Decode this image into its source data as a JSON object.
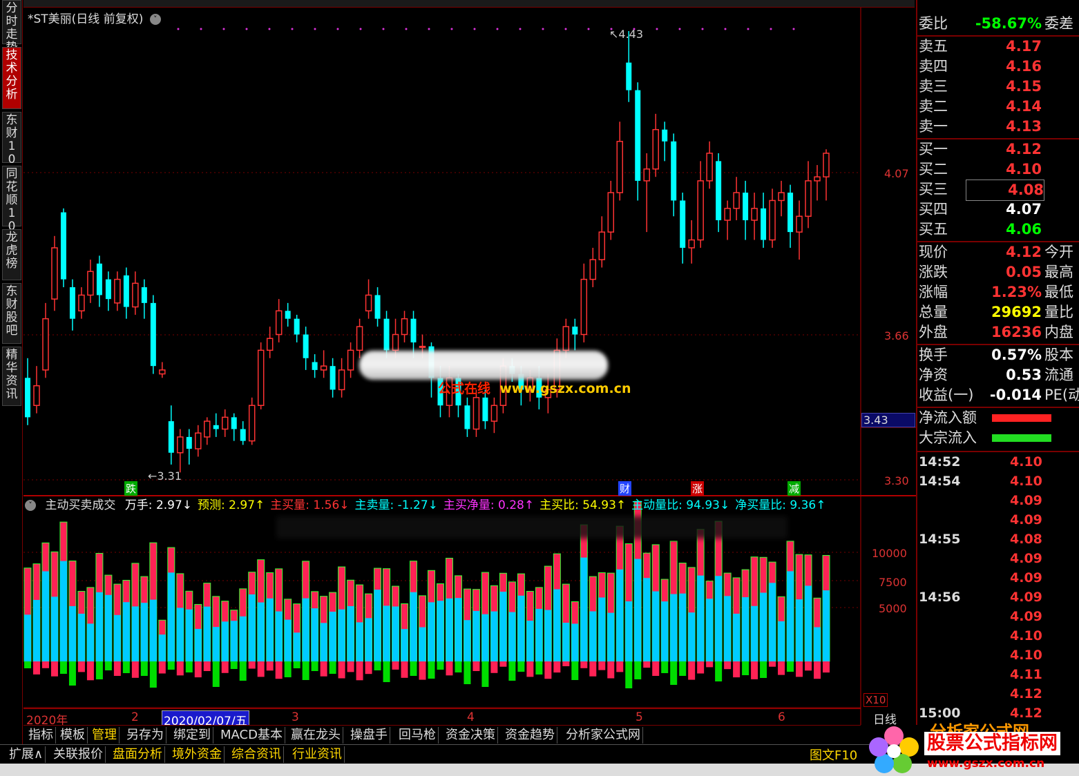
{
  "left_tabs": [
    {
      "label": "分时走势",
      "active": false
    },
    {
      "label": "技术分析",
      "active": true
    },
    {
      "label": "东财10",
      "active": false
    },
    {
      "label": "同花顺10",
      "active": false
    },
    {
      "label": "龙虎榜",
      "active": false
    },
    {
      "label": "东财股吧",
      "active": false
    },
    {
      "label": "精华资讯",
      "active": false
    }
  ],
  "chart_title": "*ST美丽(日线 前复权)",
  "title_icon": "chevron-down-icon",
  "price_axis": {
    "labels": [
      "4.07",
      "3.66",
      "3.30"
    ],
    "current_price": "3.43"
  },
  "annotations": {
    "high": "4.43",
    "low": "3.31"
  },
  "event_markers": [
    {
      "label": "跌",
      "color": "#00aa00"
    },
    {
      "label": "财",
      "color": "#2244ff"
    },
    {
      "label": "涨",
      "color": "#cc0000"
    },
    {
      "label": "减",
      "color": "#00aa00"
    }
  ],
  "indicator_header": {
    "name": "主动买卖成交",
    "items": [
      {
        "text": "万手: 2.97↓",
        "color": "#ffffff"
      },
      {
        "text": "预测: 2.97↑",
        "color": "#ffff00"
      },
      {
        "text": "主买量: 1.56↓",
        "color": "#ff3333"
      },
      {
        "text": "主卖量: -1.27↓",
        "color": "#00ffff"
      },
      {
        "text": "主买净量: 0.28↑",
        "color": "#ff33ff"
      },
      {
        "text": "主买比: 54.93↑",
        "color": "#ffff00"
      },
      {
        "text": "主动量比: 94.93↓",
        "color": "#00ffff"
      },
      {
        "text": "净买量比: 9.36↑",
        "color": "#00ffff"
      }
    ]
  },
  "volume_axis": {
    "labels": [
      "10000",
      "7500",
      "5000"
    ],
    "unit": "X10"
  },
  "date_axis": [
    {
      "label": "2020年",
      "selected": false
    },
    {
      "label": "2",
      "selected": false
    },
    {
      "label": "2020/02/07/五",
      "selected": true
    },
    {
      "label": "3",
      "selected": false
    },
    {
      "label": "4",
      "selected": false
    },
    {
      "label": "5",
      "selected": false
    },
    {
      "label": "6",
      "selected": false
    }
  ],
  "period_label": "日线",
  "bottom_tabs_1": [
    "指标",
    "模板",
    "管理",
    "另存为",
    "绑定到",
    "MACD基本",
    "赢在龙头",
    "操盘手",
    "回马枪",
    "资金决策",
    "资金趋势",
    "分析家公式网"
  ],
  "bottom_tabs_2": [
    "扩展∧",
    "关联报价",
    "盘面分析",
    "境外资金",
    "综合资讯",
    "行业资讯"
  ],
  "f10_button": "图文F10",
  "quote_panel": {
    "ratio": {
      "label": "委比",
      "value": "-58.67%",
      "ext": "委差"
    },
    "asks": [
      {
        "label": "卖五",
        "price": "4.17"
      },
      {
        "label": "卖四",
        "price": "4.16"
      },
      {
        "label": "卖三",
        "price": "4.15"
      },
      {
        "label": "卖二",
        "price": "4.14"
      },
      {
        "label": "卖一",
        "price": "4.13"
      }
    ],
    "bids": [
      {
        "label": "买一",
        "price": "4.12",
        "color": "#ff3333"
      },
      {
        "label": "买二",
        "price": "4.10",
        "color": "#ff3333"
      },
      {
        "label": "买三",
        "price": "4.08",
        "color": "#ff3333"
      },
      {
        "label": "买四",
        "price": "4.07",
        "color": "#ffffff"
      },
      {
        "label": "买五",
        "price": "4.06",
        "color": "#00ff00"
      }
    ],
    "stats": [
      {
        "label": "现价",
        "value": "4.12",
        "color": "#ff3333",
        "ext": "今开"
      },
      {
        "label": "涨跌",
        "value": "0.05",
        "color": "#ff3333",
        "ext": "最高"
      },
      {
        "label": "涨幅",
        "value": "1.23%",
        "color": "#ff3333",
        "ext": "最低"
      },
      {
        "label": "总量",
        "value": "29692",
        "color": "#ffff00",
        "ext": "量比"
      },
      {
        "label": "外盘",
        "value": "16236",
        "color": "#ff3333",
        "ext": "内盘"
      }
    ],
    "stats2": [
      {
        "label": "换手",
        "value": "0.57%",
        "color": "#ffffff",
        "ext": "股本"
      },
      {
        "label": "净资",
        "value": "0.53",
        "color": "#ffffff",
        "ext": "流通"
      },
      {
        "label": "收益(一)",
        "value": "-0.014",
        "color": "#ffffff",
        "ext": "PE(动"
      }
    ],
    "flows": [
      {
        "label": "净流入额",
        "color": "#ff2222"
      },
      {
        "label": "大宗流入",
        "color": "#22dd22"
      }
    ],
    "ticks": [
      {
        "time": "14:52",
        "price": "4.10"
      },
      {
        "time": "14:54",
        "price": "4.10"
      },
      {
        "time": "",
        "price": "4.09"
      },
      {
        "time": "",
        "price": "4.09"
      },
      {
        "time": "14:55",
        "price": "4.08"
      },
      {
        "time": "",
        "price": "4.09"
      },
      {
        "time": "",
        "price": "4.09"
      },
      {
        "time": "14:56",
        "price": "4.09"
      },
      {
        "time": "",
        "price": "4.09"
      },
      {
        "time": "",
        "price": "4.10"
      },
      {
        "time": "",
        "price": "4.10"
      },
      {
        "time": "",
        "price": "4.11"
      },
      {
        "time": "",
        "price": "4.12"
      },
      {
        "time": "15:00",
        "price": "4.12"
      }
    ]
  },
  "watermark": {
    "text": "公式在线",
    "url": "www.gszx.com.cn"
  },
  "logo": {
    "title": "分析家公式网",
    "text": "股票公式指标网",
    "url": "www.gszx.com.cn"
  },
  "colors": {
    "up": "#ff3333",
    "down": "#00ffff",
    "frame": "#b00000",
    "buy_bar": "#ff2255",
    "sell_bar": "#00ccff",
    "net_bar": "#00dd00"
  },
  "chart_data": {
    "type": "candlestick",
    "ylim": [
      3.3,
      4.43
    ],
    "candles": [
      [
        3.55,
        3.45,
        3.6,
        3.43
      ],
      [
        3.48,
        3.53,
        3.58,
        3.46
      ],
      [
        3.57,
        3.7,
        3.74,
        3.55
      ],
      [
        3.75,
        3.88,
        3.91,
        3.72
      ],
      [
        3.97,
        3.8,
        3.98,
        3.78
      ],
      [
        3.78,
        3.7,
        3.8,
        3.67
      ],
      [
        3.72,
        3.76,
        3.78,
        3.7
      ],
      [
        3.76,
        3.82,
        3.85,
        3.74
      ],
      [
        3.84,
        3.76,
        3.86,
        3.73
      ],
      [
        3.8,
        3.75,
        3.82,
        3.72
      ],
      [
        3.74,
        3.8,
        3.82,
        3.72
      ],
      [
        3.81,
        3.73,
        3.83,
        3.7
      ],
      [
        3.73,
        3.79,
        3.82,
        3.71
      ],
      [
        3.78,
        3.74,
        3.8,
        3.7
      ],
      [
        3.74,
        3.58,
        3.76,
        3.56
      ],
      [
        3.56,
        3.57,
        3.59,
        3.55
      ],
      [
        3.44,
        3.36,
        3.48,
        3.33
      ],
      [
        3.36,
        3.4,
        3.42,
        3.31
      ],
      [
        3.4,
        3.37,
        3.42,
        3.33
      ],
      [
        3.37,
        3.41,
        3.43,
        3.35
      ],
      [
        3.4,
        3.44,
        3.45,
        3.38
      ],
      [
        3.43,
        3.42,
        3.46,
        3.4
      ],
      [
        3.42,
        3.45,
        3.47,
        3.4
      ],
      [
        3.45,
        3.42,
        3.46,
        3.39
      ],
      [
        3.42,
        3.39,
        3.44,
        3.38
      ],
      [
        3.39,
        3.48,
        3.5,
        3.38
      ],
      [
        3.48,
        3.62,
        3.64,
        3.47
      ],
      [
        3.62,
        3.65,
        3.68,
        3.6
      ],
      [
        3.66,
        3.72,
        3.75,
        3.64
      ],
      [
        3.72,
        3.7,
        3.74,
        3.68
      ],
      [
        3.7,
        3.66,
        3.71,
        3.64
      ],
      [
        3.66,
        3.6,
        3.68,
        3.57
      ],
      [
        3.59,
        3.57,
        3.61,
        3.55
      ],
      [
        3.57,
        3.58,
        3.62,
        3.55
      ],
      [
        3.58,
        3.52,
        3.6,
        3.5
      ],
      [
        3.52,
        3.57,
        3.6,
        3.5
      ],
      [
        3.57,
        3.62,
        3.64,
        3.55
      ],
      [
        3.62,
        3.68,
        3.7,
        3.6
      ],
      [
        3.72,
        3.76,
        3.8,
        3.7
      ],
      [
        3.76,
        3.7,
        3.78,
        3.68
      ],
      [
        3.7,
        3.62,
        3.72,
        3.6
      ],
      [
        3.62,
        3.66,
        3.7,
        3.6
      ],
      [
        3.66,
        3.7,
        3.72,
        3.64
      ],
      [
        3.7,
        3.64,
        3.72,
        3.6
      ],
      [
        3.63,
        3.63,
        3.66,
        3.6
      ],
      [
        3.63,
        3.55,
        3.64,
        3.5
      ],
      [
        3.55,
        3.48,
        3.58,
        3.45
      ],
      [
        3.48,
        3.55,
        3.58,
        3.45
      ],
      [
        3.55,
        3.48,
        3.56,
        3.45
      ],
      [
        3.48,
        3.42,
        3.5,
        3.4
      ],
      [
        3.42,
        3.5,
        3.52,
        3.4
      ],
      [
        3.5,
        3.44,
        3.52,
        3.42
      ],
      [
        3.44,
        3.48,
        3.5,
        3.41
      ],
      [
        3.48,
        3.58,
        3.6,
        3.46
      ],
      [
        3.58,
        3.56,
        3.6,
        3.54
      ],
      [
        3.56,
        3.52,
        3.58,
        3.48
      ],
      [
        3.52,
        3.55,
        3.57,
        3.49
      ],
      [
        3.55,
        3.5,
        3.58,
        3.47
      ],
      [
        3.5,
        3.52,
        3.56,
        3.46
      ],
      [
        3.52,
        3.62,
        3.65,
        3.5
      ],
      [
        3.62,
        3.68,
        3.7,
        3.6
      ],
      [
        3.68,
        3.66,
        3.7,
        3.62
      ],
      [
        3.66,
        3.8,
        3.84,
        3.64
      ],
      [
        3.8,
        3.85,
        3.88,
        3.78
      ],
      [
        3.85,
        3.92,
        3.96,
        3.83
      ],
      [
        3.92,
        4.02,
        4.05,
        3.9
      ],
      [
        4.02,
        4.15,
        4.2,
        4.0
      ],
      [
        4.35,
        4.28,
        4.43,
        4.25
      ],
      [
        4.28,
        4.05,
        4.3,
        4.0
      ],
      [
        4.05,
        4.08,
        4.12,
        3.92
      ],
      [
        4.08,
        4.18,
        4.22,
        4.06
      ],
      [
        4.18,
        4.15,
        4.2,
        4.1
      ],
      [
        4.15,
        4.0,
        4.17,
        3.96
      ],
      [
        4.0,
        3.88,
        4.02,
        3.84
      ],
      [
        3.88,
        3.9,
        3.95,
        3.84
      ],
      [
        3.9,
        4.05,
        4.1,
        3.88
      ],
      [
        4.05,
        4.12,
        4.15,
        4.03
      ],
      [
        4.1,
        3.95,
        4.12,
        3.92
      ],
      [
        3.95,
        3.98,
        4.0,
        3.9
      ],
      [
        3.98,
        4.02,
        4.06,
        3.95
      ],
      [
        4.02,
        3.95,
        4.05,
        3.9
      ],
      [
        3.95,
        3.98,
        4.02,
        3.9
      ],
      [
        3.98,
        3.9,
        4.02,
        3.88
      ],
      [
        3.9,
        4.0,
        4.03,
        3.88
      ],
      [
        4.0,
        4.02,
        4.05,
        3.96
      ],
      [
        4.02,
        3.92,
        4.04,
        3.88
      ],
      [
        3.92,
        3.96,
        4.0,
        3.85
      ],
      [
        3.96,
        4.05,
        4.1,
        3.93
      ],
      [
        4.05,
        4.06,
        4.09,
        4.0
      ],
      [
        4.06,
        4.12,
        4.13,
        4.0
      ]
    ]
  }
}
